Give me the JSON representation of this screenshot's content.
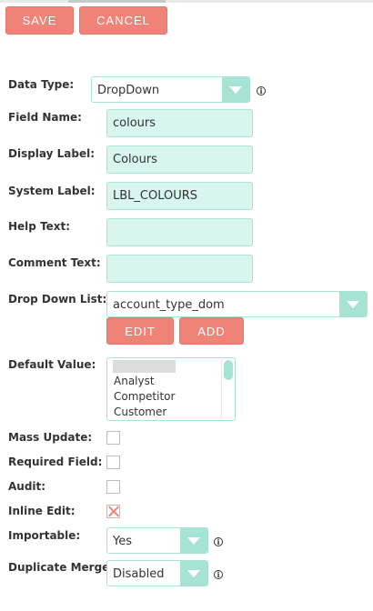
{
  "toolbar": {
    "save_label": "SAVE",
    "cancel_label": "CANCEL"
  },
  "labels": {
    "data_type": "Data Type:",
    "field_name": "Field Name:",
    "display_label": "Display Label:",
    "system_label": "System Label:",
    "help_text": "Help Text:",
    "comment_text": "Comment Text:",
    "drop_down_list": "Drop Down List:",
    "default_value": "Default Value:",
    "mass_update": "Mass Update:",
    "required_field": "Required Field:",
    "audit": "Audit:",
    "inline_edit": "Inline Edit:",
    "importable": "Importable:",
    "duplicate_merge": "Duplicate Merge:"
  },
  "fields": {
    "data_type": "DropDown",
    "field_name": "colours",
    "display_label": "Colours",
    "system_label": "LBL_COLOURS",
    "help_text": "",
    "comment_text": "",
    "drop_down_list": "account_type_dom",
    "importable": "Yes",
    "duplicate_merge": "Disabled"
  },
  "dropdown_buttons": {
    "edit_label": "EDIT",
    "add_label": "ADD"
  },
  "default_value_options": [
    "",
    "Analyst",
    "Competitor",
    "Customer"
  ],
  "checkboxes": {
    "mass_update": false,
    "required_field": false,
    "audit": false,
    "inline_edit": true
  },
  "info_icon_glyph": "i",
  "colors": {
    "button": "#f08377",
    "input_bg": "#d8f5ee",
    "accent": "#a6e3d4"
  }
}
